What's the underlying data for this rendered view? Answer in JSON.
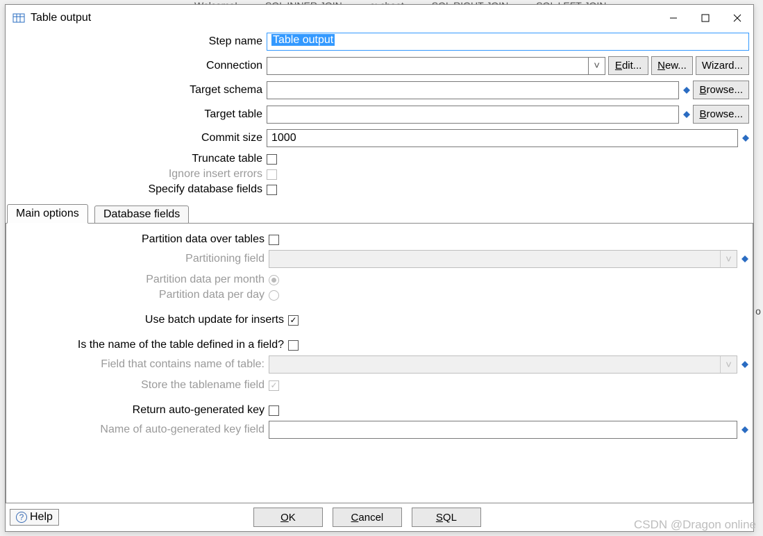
{
  "bg_tabs": [
    "Welcome!",
    "SQL INNER JOIN",
    "c: cheet",
    "SQL RIGHT JOIN",
    "SQL LEFT JOIN"
  ],
  "window": {
    "title": "Table output"
  },
  "form": {
    "step_name_label": "Step name",
    "step_name_value": "Table output",
    "connection_label": "Connection",
    "connection_value": "",
    "edit_label_pre": "E",
    "edit_label_uf": "dit...",
    "new_label_pre": "N",
    "new_label_uf": "ew...",
    "wizard_label": "Wizard...",
    "target_schema_label": "Target schema",
    "target_schema_value": "",
    "target_table_label": "Target table",
    "target_table_value": "",
    "browse_label_pre": "B",
    "browse_label_uf": "rowse...",
    "commit_size_label": "Commit size",
    "commit_size_value": "1000",
    "truncate_label": "Truncate table",
    "ignore_errors_label": "Ignore insert errors",
    "specify_fields_label": "Specify database fields"
  },
  "tabs": {
    "main": "Main options",
    "dbfields": "Database fields"
  },
  "main": {
    "partition_over_tables_label": "Partition data over tables",
    "partitioning_field_label": "Partitioning field",
    "partition_per_month_label": "Partition data per month",
    "partition_per_day_label": "Partition data per day",
    "batch_update_label": "Use batch update for inserts",
    "name_in_field_label": "Is the name of the table defined in a field?",
    "field_tablename_label": "Field that contains name of table:",
    "store_tablename_label": "Store the tablename field",
    "return_key_label": "Return auto-generated key",
    "name_key_field_label": "Name of auto-generated key field"
  },
  "buttons": {
    "help": "Help",
    "ok_pre": "O",
    "ok_uf": "K",
    "cancel_pre": "C",
    "cancel_uf": "ancel",
    "sql_pre": "S",
    "sql_uf": "QL"
  },
  "watermark": "CSDN @Dragon online"
}
